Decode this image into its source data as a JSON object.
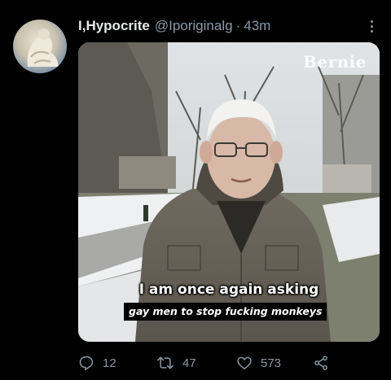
{
  "tweet": {
    "display_name": "I,Hypocrite",
    "handle": "@Iporiginalg",
    "separator": "·",
    "time": "43m"
  },
  "media": {
    "watermark": "Bernie",
    "caption_line1": "I am once again asking",
    "caption_line2": "gay men to stop fucking monkeys"
  },
  "actions": {
    "reply_count": "12",
    "retweet_count": "47",
    "like_count": "573"
  },
  "colors": {
    "background": "#000000",
    "text_primary": "#e7e9ea",
    "text_secondary": "#8b98a5"
  },
  "icons": [
    "more-icon",
    "reply-icon",
    "retweet-icon",
    "like-icon",
    "share-icon"
  ]
}
